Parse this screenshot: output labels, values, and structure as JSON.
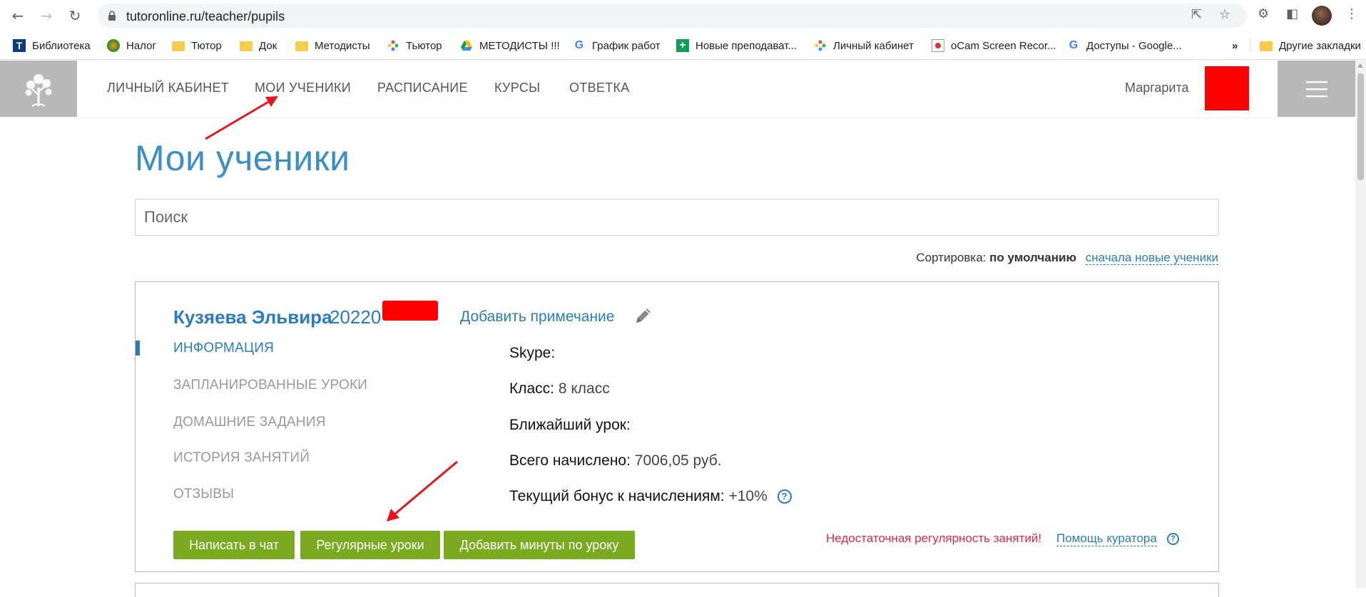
{
  "browser": {
    "url": "tutoronline.ru/teacher/pupils",
    "bookmarks": [
      {
        "label": "Библиотека",
        "icon": "t-logo-icon"
      },
      {
        "label": "Налог",
        "icon": "tax-globe-icon"
      },
      {
        "label": "Тютор",
        "icon": "folder-icon"
      },
      {
        "label": "Док",
        "icon": "folder-icon"
      },
      {
        "label": "Методисты",
        "icon": "folder-icon"
      },
      {
        "label": "Тьютор",
        "icon": "pinwheel-icon"
      },
      {
        "label": "МЕТОДИСТЫ !!!",
        "icon": "drive-icon"
      },
      {
        "label": "График работ",
        "icon": "google-icon"
      },
      {
        "label": "Новые преподават...",
        "icon": "sheets-plus-icon"
      },
      {
        "label": "Личный кабинет",
        "icon": "pinwheel-icon"
      },
      {
        "label": "oCam Screen Recor...",
        "icon": "ocam-icon"
      },
      {
        "label": "Доступы - Google...",
        "icon": "google-icon"
      }
    ],
    "more_bookmarks": "»",
    "other_bookmarks": "Другие закладки"
  },
  "site": {
    "nav": [
      "ЛИЧНЫЙ КАБИНЕТ",
      "МОИ УЧЕНИКИ",
      "РАСПИСАНИЕ",
      "КУРСЫ",
      "ОТВЕТКА"
    ],
    "user_name": "Маргарита"
  },
  "page": {
    "title": "Мои ученики",
    "search_placeholder": "Поиск",
    "sort_label": "Сортировка:",
    "sort_current": "по умолчанию",
    "sort_alt": "сначала новые ученики"
  },
  "pupil": {
    "name": "Кузяева Эльвира",
    "id_visible": "20220",
    "add_note": "Добавить примечание",
    "tabs": [
      "ИНФОРМАЦИЯ",
      "ЗАПЛАНИРОВАННЫЕ УРОКИ",
      "ДОМАШНИЕ ЗАДАНИЯ",
      "ИСТОРИЯ ЗАНЯТИЙ",
      "ОТЗЫВЫ"
    ],
    "info": {
      "skype_label": "Skype:",
      "class_label": "Класс:",
      "class_value": "8 класс",
      "next_lesson_label": "Ближайший урок:",
      "total_label": "Всего начислено:",
      "total_value": "7006,05 руб.",
      "bonus_label": "Текущий бонус к начислениям:",
      "bonus_value": "+10%"
    },
    "buttons": {
      "chat": "Написать в чат",
      "regular": "Регулярные уроки",
      "add_minutes": "Добавить минуты по уроку"
    },
    "warning": "Недостаточная регулярность занятий!",
    "curator_help": "Помощь куратора"
  },
  "colors": {
    "accent_blue": "#2a7dbd",
    "button_green": "#7aaa20",
    "warning_red": "#e0264c",
    "annotation_red": "#e8141c",
    "card_border": "#e6a7b7"
  }
}
